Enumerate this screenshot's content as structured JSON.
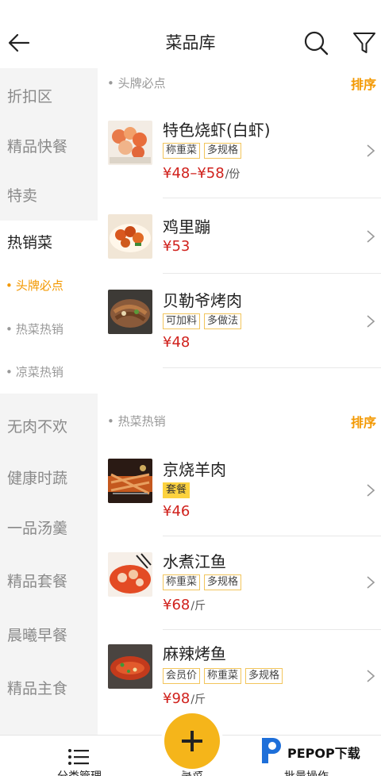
{
  "header": {
    "title": "菜品库"
  },
  "sidebar": {
    "items": [
      {
        "label": "折扣区"
      },
      {
        "label": "精品快餐"
      },
      {
        "label": "特卖"
      },
      {
        "label": "热销菜"
      }
    ],
    "subs": [
      {
        "label": "头牌必点",
        "dot": "•"
      },
      {
        "label": "热菜热销",
        "dot": "•"
      },
      {
        "label": "凉菜热销",
        "dot": "•"
      }
    ],
    "items2": [
      {
        "label": "无肉不欢"
      },
      {
        "label": "健康时蔬"
      },
      {
        "label": "一品汤羹"
      },
      {
        "label": "精品套餐"
      },
      {
        "label": "晨曦早餐"
      },
      {
        "label": "精品主食"
      }
    ]
  },
  "sections": [
    {
      "name": "• 头牌必点",
      "sort": "排序",
      "dishes": [
        {
          "name": "特色烧虾(白虾)",
          "tags": [
            "称重菜",
            "多规格"
          ],
          "price": "¥48–¥58",
          "unit": "/份"
        },
        {
          "name": "鸡里蹦",
          "tags": [],
          "price": "¥53",
          "unit": ""
        },
        {
          "name": "贝勒爷烤肉",
          "tags": [
            "可加料",
            "多做法"
          ],
          "price": "¥48",
          "unit": ""
        }
      ]
    },
    {
      "name": "• 热菜热销",
      "sort": "排序",
      "dishes": [
        {
          "name": "京烧羊肉",
          "tags": [
            "套餐"
          ],
          "price": "¥46",
          "unit": ""
        },
        {
          "name": "水煮江鱼",
          "tags": [
            "称重菜",
            "多规格"
          ],
          "price": "¥68",
          "unit": "/斤"
        },
        {
          "name": "麻辣烤鱼",
          "tags": [
            "会员价",
            "称重菜",
            "多规格"
          ],
          "price": "¥98",
          "unit": "/斤"
        }
      ]
    }
  ],
  "bottom": {
    "left_label": "分类管理",
    "center_label": "录菜",
    "right_label": "批量操作",
    "watermark": "PEPOP下载"
  },
  "colors": {
    "accent": "#f39800",
    "price": "#d0211c",
    "tag_border": "#f2c55c",
    "fab": "#f5b51a"
  }
}
